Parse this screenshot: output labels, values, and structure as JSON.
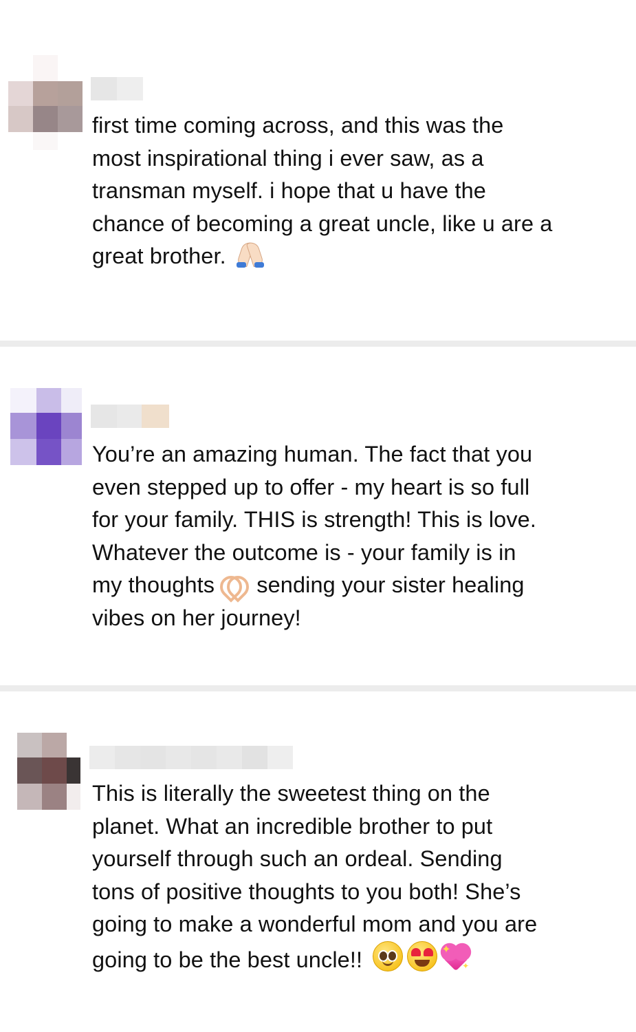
{
  "comments": [
    {
      "lines": [
        "first time coming across, and this was the",
        "most inspirational thing i ever saw, as a",
        "transman myself. i hope that u have the",
        "chance of becoming a great uncle, like u are a",
        "great brother."
      ],
      "emojis": [
        "praying-hands"
      ]
    },
    {
      "lines": [
        "You’re an amazing human. The fact that you",
        "even stepped up to offer - my heart is so full",
        "for your family. THIS is strength! This is love.",
        "Whatever the outcome is - your family is in",
        "my thoughts",
        "sending your sister healing",
        "vibes on her journey!"
      ],
      "emojis": [
        "heart-hands"
      ]
    },
    {
      "lines": [
        "This is literally the sweetest thing on the",
        "planet. What an incredible brother to put",
        "yourself through such an ordeal. Sending",
        "tons of positive thoughts to you both! She’s",
        "going to make a wonderful mom and you are",
        "going to be the best uncle!!"
      ],
      "emojis": [
        "pleading-face",
        "heart-eyes-face",
        "sparkling-heart"
      ]
    }
  ],
  "colors": {
    "text": "#111111",
    "divider": "#ececec",
    "background": "#ffffff"
  }
}
